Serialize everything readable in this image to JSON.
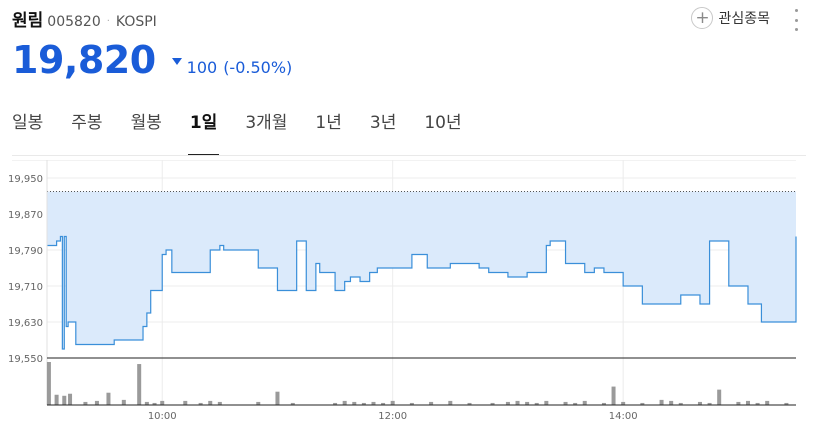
{
  "header": {
    "name": "원림",
    "code": "005820",
    "separator": "·",
    "market": "KOSPI",
    "watch_label": "관심종목",
    "watch_icon": "plus-icon",
    "more_icon": "more-vertical-icon"
  },
  "price": {
    "current": "19,820",
    "direction": "down",
    "change": "100",
    "change_pct": "(-0.50%)",
    "color": "#1a5cd8"
  },
  "tabs": [
    "일봉",
    "주봉",
    "월봉",
    "1일",
    "3개월",
    "1년",
    "3년",
    "10년"
  ],
  "active_tab": "1일",
  "chart_data": {
    "type": "line",
    "line_color": "#3a8fd9",
    "fill_color": "#dbeafb",
    "volume_color": "#9a9a9a",
    "yticks": [
      "19,950",
      "19,870",
      "19,790",
      "19,710",
      "19,630",
      "19,550"
    ],
    "ytick_values": [
      19950,
      19870,
      19790,
      19710,
      19630,
      19550
    ],
    "ylim": [
      19550,
      19950
    ],
    "xticks": [
      "10:00",
      "12:00",
      "14:00"
    ],
    "xtick_values": [
      60,
      180,
      300
    ],
    "xlim": [
      0,
      390
    ],
    "reference_price": 19920,
    "x": [
      0,
      5,
      7,
      8,
      9,
      10,
      11,
      12,
      15,
      20,
      35,
      38,
      50,
      52,
      54,
      58,
      60,
      62,
      65,
      68,
      70,
      80,
      85,
      90,
      92,
      95,
      98,
      100,
      110,
      120,
      125,
      128,
      130,
      135,
      138,
      140,
      142,
      145,
      150,
      155,
      158,
      160,
      163,
      165,
      168,
      170,
      172,
      175,
      180,
      190,
      195,
      198,
      200,
      210,
      215,
      220,
      225,
      230,
      232,
      240,
      245,
      250,
      255,
      260,
      262,
      270,
      280,
      285,
      290,
      295,
      300,
      310,
      320,
      325,
      330,
      335,
      340,
      345,
      352,
      355,
      360,
      365,
      370,
      372,
      390
    ],
    "values": [
      19800,
      19810,
      19820,
      19570,
      19820,
      19620,
      19630,
      19630,
      19580,
      19580,
      19590,
      19590,
      19620,
      19650,
      19700,
      19700,
      19780,
      19790,
      19740,
      19740,
      19740,
      19740,
      19790,
      19800,
      19790,
      19790,
      19790,
      19790,
      19750,
      19700,
      19700,
      19700,
      19810,
      19700,
      19700,
      19760,
      19740,
      19740,
      19700,
      19720,
      19730,
      19730,
      19720,
      19720,
      19740,
      19740,
      19750,
      19750,
      19750,
      19780,
      19780,
      19750,
      19750,
      19760,
      19760,
      19760,
      19750,
      19740,
      19740,
      19730,
      19730,
      19740,
      19740,
      19800,
      19810,
      19760,
      19740,
      19750,
      19740,
      19740,
      19710,
      19670,
      19670,
      19670,
      19690,
      19690,
      19670,
      19810,
      19810,
      19710,
      19710,
      19670,
      19670,
      19630,
      19820
    ],
    "volume_x": [
      1,
      5,
      9,
      12,
      20,
      26,
      32,
      40,
      48,
      52,
      56,
      60,
      72,
      80,
      85,
      90,
      110,
      120,
      128,
      150,
      155,
      160,
      165,
      170,
      175,
      180,
      190,
      200,
      210,
      220,
      232,
      240,
      245,
      250,
      255,
      260,
      270,
      275,
      280,
      290,
      295,
      300,
      310,
      320,
      325,
      330,
      340,
      345,
      350,
      360,
      365,
      370,
      375,
      385
    ],
    "volume": [
      42,
      10,
      9,
      11,
      3,
      4,
      12,
      5,
      40,
      3,
      2,
      4,
      4,
      2,
      4,
      3,
      3,
      13,
      2,
      2,
      4,
      3,
      2,
      3,
      2,
      4,
      2,
      3,
      4,
      2,
      2,
      3,
      4,
      3,
      2,
      4,
      3,
      2,
      4,
      2,
      18,
      3,
      2,
      5,
      4,
      2,
      3,
      2,
      15,
      3,
      4,
      2,
      4,
      2
    ]
  }
}
